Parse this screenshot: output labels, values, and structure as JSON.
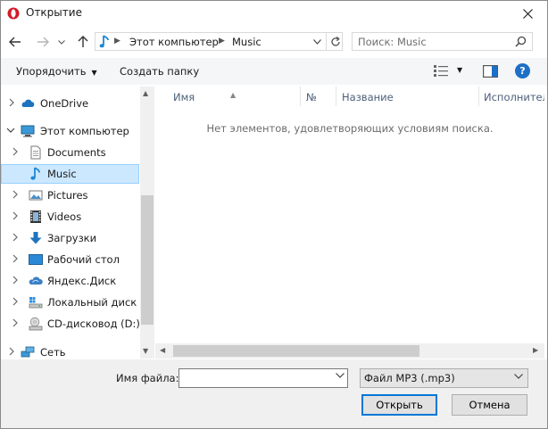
{
  "window": {
    "title": "Открытие",
    "close_glyph": "✕"
  },
  "nav": {
    "breadcrumbs": [
      "Этот компьютер",
      "Music"
    ],
    "search_placeholder": "Поиск: Music"
  },
  "toolbar": {
    "organize_label": "Упорядочить",
    "new_folder_label": "Создать папку",
    "help_glyph": "?"
  },
  "sidebar": {
    "items": [
      {
        "label": "OneDrive",
        "icon": "cloud-icon",
        "level": 0,
        "expanded": false
      },
      {
        "label": "Этот компьютер",
        "icon": "computer-icon",
        "level": 0,
        "expanded": true
      },
      {
        "label": "Documents",
        "icon": "documents-icon",
        "level": 1,
        "expanded": false
      },
      {
        "label": "Music",
        "icon": "music-note-icon",
        "level": 1,
        "expanded": false,
        "selected": true
      },
      {
        "label": "Pictures",
        "icon": "pictures-icon",
        "level": 1,
        "expanded": false
      },
      {
        "label": "Videos",
        "icon": "videos-icon",
        "level": 1,
        "expanded": false
      },
      {
        "label": "Загрузки",
        "icon": "download-icon",
        "level": 1,
        "expanded": false
      },
      {
        "label": "Рабочий стол",
        "icon": "desktop-icon",
        "level": 1,
        "expanded": false
      },
      {
        "label": "Яндекс.Диск",
        "icon": "cloud-disk-icon",
        "level": 1,
        "expanded": false
      },
      {
        "label": "Локальный диск (C",
        "icon": "drive-icon",
        "level": 1,
        "expanded": false
      },
      {
        "label": "CD-дисковод (D:)",
        "icon": "cd-drive-icon",
        "level": 1,
        "expanded": false
      },
      {
        "label": "Сеть",
        "icon": "network-icon",
        "level": 0,
        "expanded": false
      }
    ]
  },
  "content": {
    "columns": [
      "Имя",
      "№",
      "Название",
      "Исполнитель"
    ],
    "empty_message": "Нет элементов, удовлетворяющих условиям поиска."
  },
  "bottom": {
    "filename_label": "Имя файла:",
    "filename_value": "",
    "filetype_value": "Файл MP3 (.mp3)",
    "open_label": "Открыть",
    "cancel_label": "Отмена"
  },
  "colors": {
    "accent": "#0078d7",
    "selection": "#cce8ff",
    "opera_red": "#d31a27"
  }
}
